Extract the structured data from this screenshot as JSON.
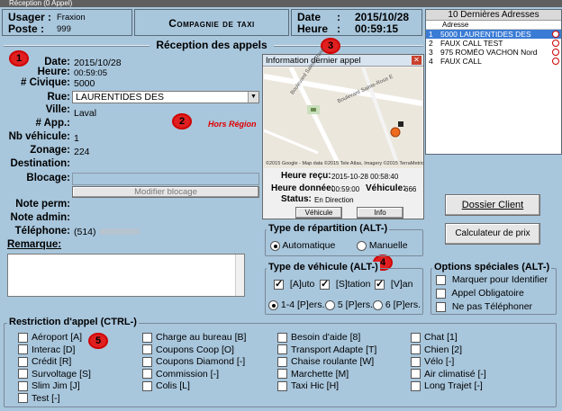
{
  "window_title": "Réception (0 Appel)",
  "user": {
    "usager_label": "Usager :",
    "usager": "Fraxion",
    "poste_label": "Poste :",
    "poste": "999"
  },
  "company": "Compagnie de taxi",
  "datetime": {
    "date_label": "Date",
    "date": "2015/10/28",
    "heure_label": "Heure",
    "heure": "00:59:15",
    "colon": ":"
  },
  "addresses": {
    "title": "10 Dernières Adresses",
    "col": "Adresse",
    "rows": [
      {
        "n": "1",
        "addr": "5000 LAURENTIDES DES",
        "selected": true
      },
      {
        "n": "2",
        "addr": "FAUX CALL TEST",
        "selected": false
      },
      {
        "n": "3",
        "addr": "975 ROMÉO VACHON Nord",
        "selected": false
      },
      {
        "n": "4",
        "addr": "FAUX CALL",
        "selected": false
      }
    ]
  },
  "section_title": "Réception des appels",
  "markers": [
    "1",
    "2",
    "3",
    "4",
    "5"
  ],
  "form": {
    "date_label": "Date:",
    "date": "2015/10/28",
    "heure_label": "Heure:",
    "heure": "00:59:05",
    "civique_label": "# Civique:",
    "civique": "5000",
    "rue_label": "Rue:",
    "rue": "LAURENTIDES DES",
    "ville_label": "Ville:",
    "ville": "Laval",
    "app_label": "# App.:",
    "nbveh_label": "Nb véhicule:",
    "nbveh": "1",
    "zonage_label": "Zonage:",
    "zonage": "224",
    "dest_label": "Destination:",
    "blocage_label": "Blocage:",
    "modifier_blocage": "Modifier blocage",
    "noteperm_label": "Note perm:",
    "noteadmin_label": "Note admin:",
    "tel_label": "Téléphone:",
    "tel": "(514)",
    "remarque_label": "Remarque:",
    "hors_region": "Hors Région"
  },
  "info": {
    "title": "Information dernier appel",
    "map_credit": "©2015 Google - Map data ©2015 Tele Atlas, Imagery ©2015 TerraMetrics",
    "street1": "Boulevard Sainte-Rose",
    "street2": "Boulevard Sainte-Rose E",
    "recu_label": "Heure reçu:",
    "recu": "2015-10-28 00:58:40",
    "donnee_label": "Heure donnée:",
    "donnee": "00:59:00",
    "vehicule_label": "Véhicule:",
    "vehicule": "666",
    "status_label": "Status:",
    "status": "En Direction",
    "btn_vehicule": "Véhicule",
    "btn_info": "Info"
  },
  "buttons": {
    "dossier": "Dossier Client",
    "calculateur": "Calculateur de prix"
  },
  "repartition": {
    "title": "Type de répartition (ALT-)",
    "opt1": "Automatique",
    "opt2": "Manuelle"
  },
  "vehicule_type": {
    "title": "Type de véhicule (ALT-)",
    "auto": "[A]uto",
    "station": "[S]tation",
    "van": "[V]an",
    "p14": "1-4 [P]ers.",
    "p5": "5 [P]ers.",
    "p6": "6 [P]ers."
  },
  "options": {
    "title": "Options spéciales (ALT-)",
    "o1": "Marquer pour Identifier",
    "o2": "Appel Obligatoire",
    "o3": "Ne pas Téléphoner"
  },
  "restriction": {
    "title": "Restriction d'appel (CTRL-)",
    "cols": [
      [
        "Aéroport [A]",
        "Interac [D]",
        "Crédit [R]",
        "Survoltage [S]",
        "Slim Jim [J]",
        "Test [-]"
      ],
      [
        "Charge au bureau [B]",
        "Coupons Coop [O]",
        "Coupons Diamond [-]",
        "Commission [-]",
        "Colis [L]"
      ],
      [
        "Besoin d'aide [8]",
        "Transport Adapte [T]",
        "Chaise roulante [W]",
        "Marchette [M]",
        "Taxi Hic [H]"
      ],
      [
        "Chat [1]",
        "Chien [2]",
        "Vélo [-]",
        "Air climatisé [-]",
        "Long Trajet [-]"
      ]
    ]
  }
}
